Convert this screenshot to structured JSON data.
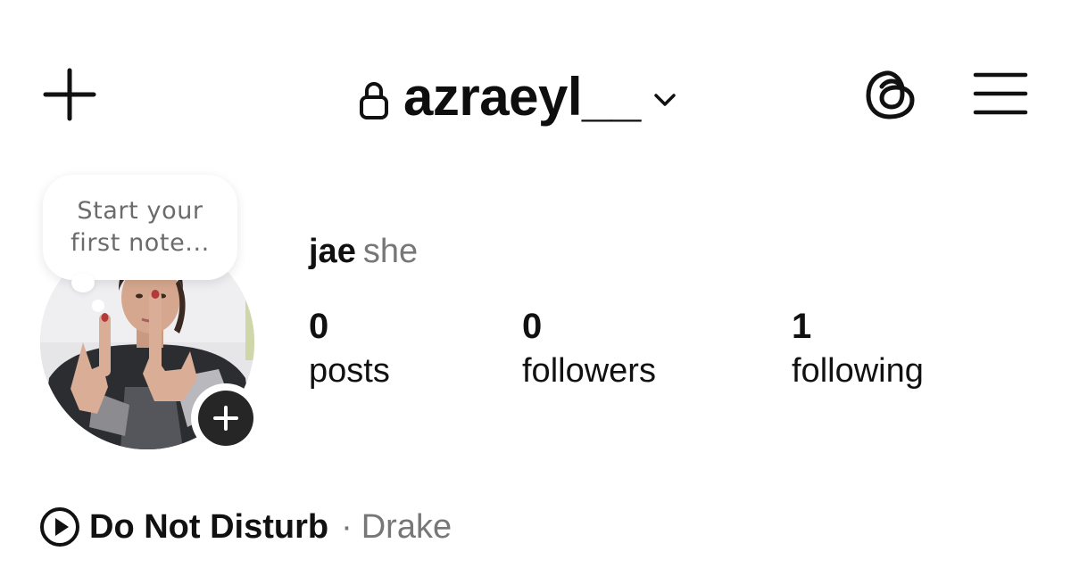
{
  "header": {
    "username": "azraeyl__",
    "icons": {
      "add": "plus-icon",
      "lock": "lock-icon",
      "switch_account": "chevron-down-icon",
      "threads": "threads-icon",
      "menu": "hamburger-menu-icon"
    }
  },
  "note": {
    "text": "Start your first note..."
  },
  "profile": {
    "avatar": "profile-photo",
    "add_story_icon": "plus-icon",
    "name": "jae",
    "pronouns": "she"
  },
  "stats": {
    "posts": {
      "value": "0",
      "label": "posts"
    },
    "followers": {
      "value": "0",
      "label": "followers"
    },
    "following": {
      "value": "1",
      "label": "following"
    }
  },
  "music": {
    "icon": "play-circle-icon",
    "title": "Do Not Disturb",
    "separator": "·",
    "artist": "Drake"
  },
  "colors": {
    "text_primary": "#111111",
    "text_secondary": "#777777",
    "add_story_bg": "#262626",
    "background": "#ffffff"
  }
}
